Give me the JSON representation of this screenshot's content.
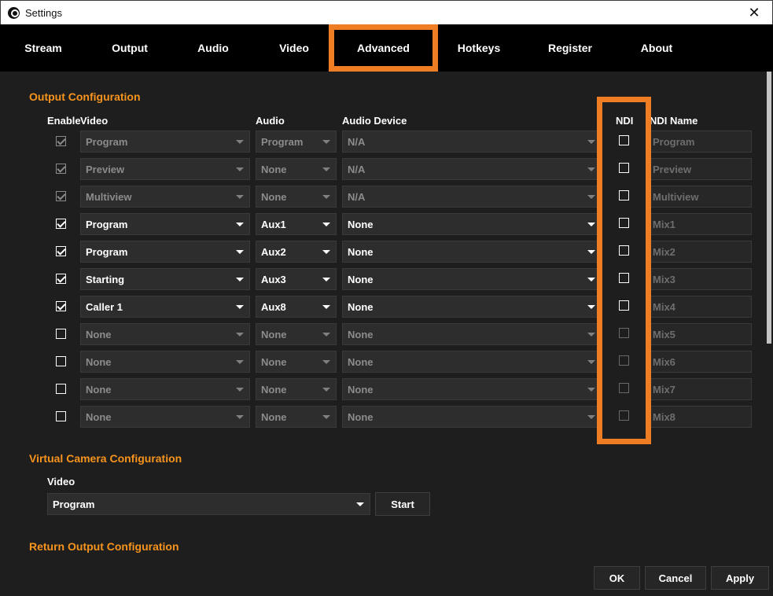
{
  "window": {
    "title": "Settings",
    "close_glyph": "✕"
  },
  "tabs": [
    {
      "label": "Stream"
    },
    {
      "label": "Output"
    },
    {
      "label": "Audio"
    },
    {
      "label": "Video"
    },
    {
      "label": "Advanced",
      "active": true
    },
    {
      "label": "Hotkeys"
    },
    {
      "label": "Register"
    },
    {
      "label": "About"
    }
  ],
  "output_config": {
    "title": "Output Configuration",
    "headers": {
      "enable": "Enable",
      "video": "Video",
      "audio": "Audio",
      "audio_device": "Audio Device",
      "ndi": "NDI",
      "ndi_name": "NDI Name"
    },
    "rows": [
      {
        "enabled": true,
        "locked": true,
        "video": "Program",
        "audio": "Program",
        "audio_device": "N/A",
        "ndi": false,
        "ndi_name": "Program"
      },
      {
        "enabled": true,
        "locked": true,
        "video": "Preview",
        "audio": "None",
        "audio_device": "N/A",
        "ndi": false,
        "ndi_name": "Preview"
      },
      {
        "enabled": true,
        "locked": true,
        "video": "Multiview",
        "audio": "None",
        "audio_device": "N/A",
        "ndi": false,
        "ndi_name": "Multiview"
      },
      {
        "enabled": true,
        "locked": false,
        "video": "Program",
        "audio": "Aux1",
        "audio_device": "None",
        "ndi": false,
        "ndi_name": "Mix1"
      },
      {
        "enabled": true,
        "locked": false,
        "video": "Program",
        "audio": "Aux2",
        "audio_device": "None",
        "ndi": false,
        "ndi_name": "Mix2"
      },
      {
        "enabled": true,
        "locked": false,
        "video": "Starting",
        "audio": "Aux3",
        "audio_device": "None",
        "ndi": false,
        "ndi_name": "Mix3"
      },
      {
        "enabled": true,
        "locked": false,
        "video": "Caller 1",
        "audio": "Aux8",
        "audio_device": "None",
        "ndi": false,
        "ndi_name": "Mix4"
      },
      {
        "enabled": false,
        "locked": false,
        "video": "None",
        "audio": "None",
        "audio_device": "None",
        "ndi": false,
        "ndi_name": "Mix5"
      },
      {
        "enabled": false,
        "locked": false,
        "video": "None",
        "audio": "None",
        "audio_device": "None",
        "ndi": false,
        "ndi_name": "Mix6"
      },
      {
        "enabled": false,
        "locked": false,
        "video": "None",
        "audio": "None",
        "audio_device": "None",
        "ndi": false,
        "ndi_name": "Mix7"
      },
      {
        "enabled": false,
        "locked": false,
        "video": "None",
        "audio": "None",
        "audio_device": "None",
        "ndi": false,
        "ndi_name": "Mix8"
      }
    ]
  },
  "virtual_camera": {
    "title": "Virtual Camera Configuration",
    "video_label": "Video",
    "video_value": "Program",
    "start_label": "Start"
  },
  "return_output": {
    "title": "Return Output Configuration"
  },
  "footer": {
    "ok_label": "OK",
    "cancel_label": "Cancel",
    "apply_label": "Apply"
  },
  "colors": {
    "accent": "#f7941d",
    "highlight": "#ee7d23",
    "background": "#1e1e1e",
    "tabbar": "#000000"
  }
}
